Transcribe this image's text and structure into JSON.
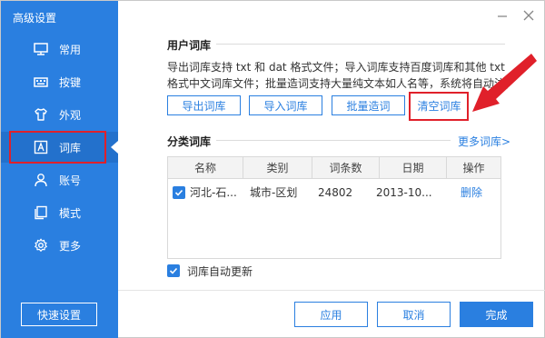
{
  "sidebar": {
    "title": "高级设置",
    "items": [
      {
        "label": "常用",
        "icon": "monitor-icon"
      },
      {
        "label": "按键",
        "icon": "keyboard-icon"
      },
      {
        "label": "外观",
        "icon": "shirt-icon"
      },
      {
        "label": "词库",
        "icon": "dictionary-icon",
        "active": true
      },
      {
        "label": "账号",
        "icon": "user-icon"
      },
      {
        "label": "模式",
        "icon": "copy-icon"
      },
      {
        "label": "更多",
        "icon": "gear-icon"
      }
    ],
    "quick_settings_label": "快速设置"
  },
  "user_dict": {
    "title": "用户词库",
    "desc_line1": "导出词库支持 txt 和 dat 格式文件；导入词库支持百度词库和其他 txt",
    "desc_line2": "格式中文词库文件；批量造词支持大量纯文本如人名等，系统将自动注音。",
    "buttons": {
      "export": "导出词库",
      "import": "导入词库",
      "batch": "批量造词",
      "clear": "清空词库"
    }
  },
  "category_dict": {
    "title": "分类词库",
    "more_link": "更多词库>",
    "columns": [
      "名称",
      "类别",
      "词条数",
      "日期",
      "操作"
    ],
    "rows": [
      {
        "checked": true,
        "name": "河北-石...",
        "category": "城市-区划",
        "count": "24802",
        "date": "2013-10...",
        "action": "删除"
      }
    ]
  },
  "auto_update": {
    "label": "词库自动更新",
    "checked": true
  },
  "footer": {
    "apply": "应用",
    "cancel": "取消",
    "done": "完成"
  },
  "colors": {
    "accent": "#2a7fe0",
    "highlight": "#e0202a"
  }
}
